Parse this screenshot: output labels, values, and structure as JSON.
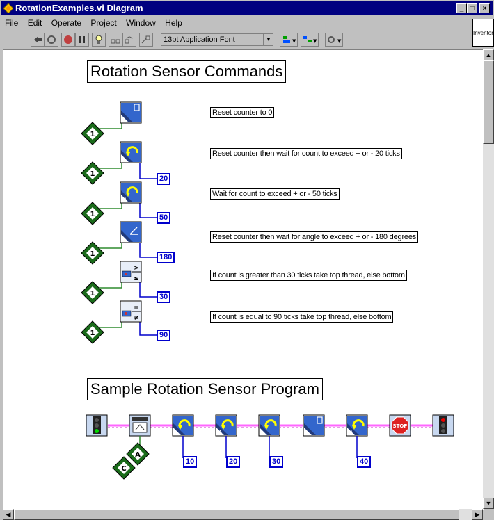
{
  "window": {
    "title": "RotationExamples.vi Diagram",
    "min_btn": "_",
    "max_btn": "□",
    "close_btn": "×"
  },
  "menu": [
    "File",
    "Edit",
    "Operate",
    "Project",
    "Window",
    "Help"
  ],
  "toolbar": {
    "font_label": "13pt Application Font"
  },
  "side_panel": {
    "label": "Inventor"
  },
  "diagram": {
    "title1": "Rotation Sensor Commands",
    "commands": [
      {
        "label": "Reset counter to 0",
        "value": ""
      },
      {
        "label": "Reset counter then wait for count to exceed + or - 20 ticks",
        "value": "20"
      },
      {
        "label": "Wait for count to exceed + or - 50 ticks",
        "value": "50"
      },
      {
        "label": "Reset counter then wait for angle to exceed + or - 180 degrees",
        "value": "180"
      },
      {
        "label": "If count is greater than 30 ticks take top thread, else bottom",
        "value": "30"
      },
      {
        "label": "If count is equal to 90 ticks take top thread, else bottom",
        "value": "90"
      }
    ],
    "port_constant": "1",
    "title2": "Sample Rotation Sensor Program",
    "program_values": [
      "10",
      "20",
      "30",
      "40"
    ],
    "port_letters": [
      "A",
      "C"
    ],
    "stop_label": "STOP",
    "counter_glyph": "0"
  },
  "colors": {
    "titlebar": "#000080",
    "wire_pink": "#ff66ff",
    "wire_green": "#2e8b2e",
    "wire_blue": "#0000cc",
    "vi_blue": "#3366cc",
    "constant_green": "#1a6b1a"
  }
}
